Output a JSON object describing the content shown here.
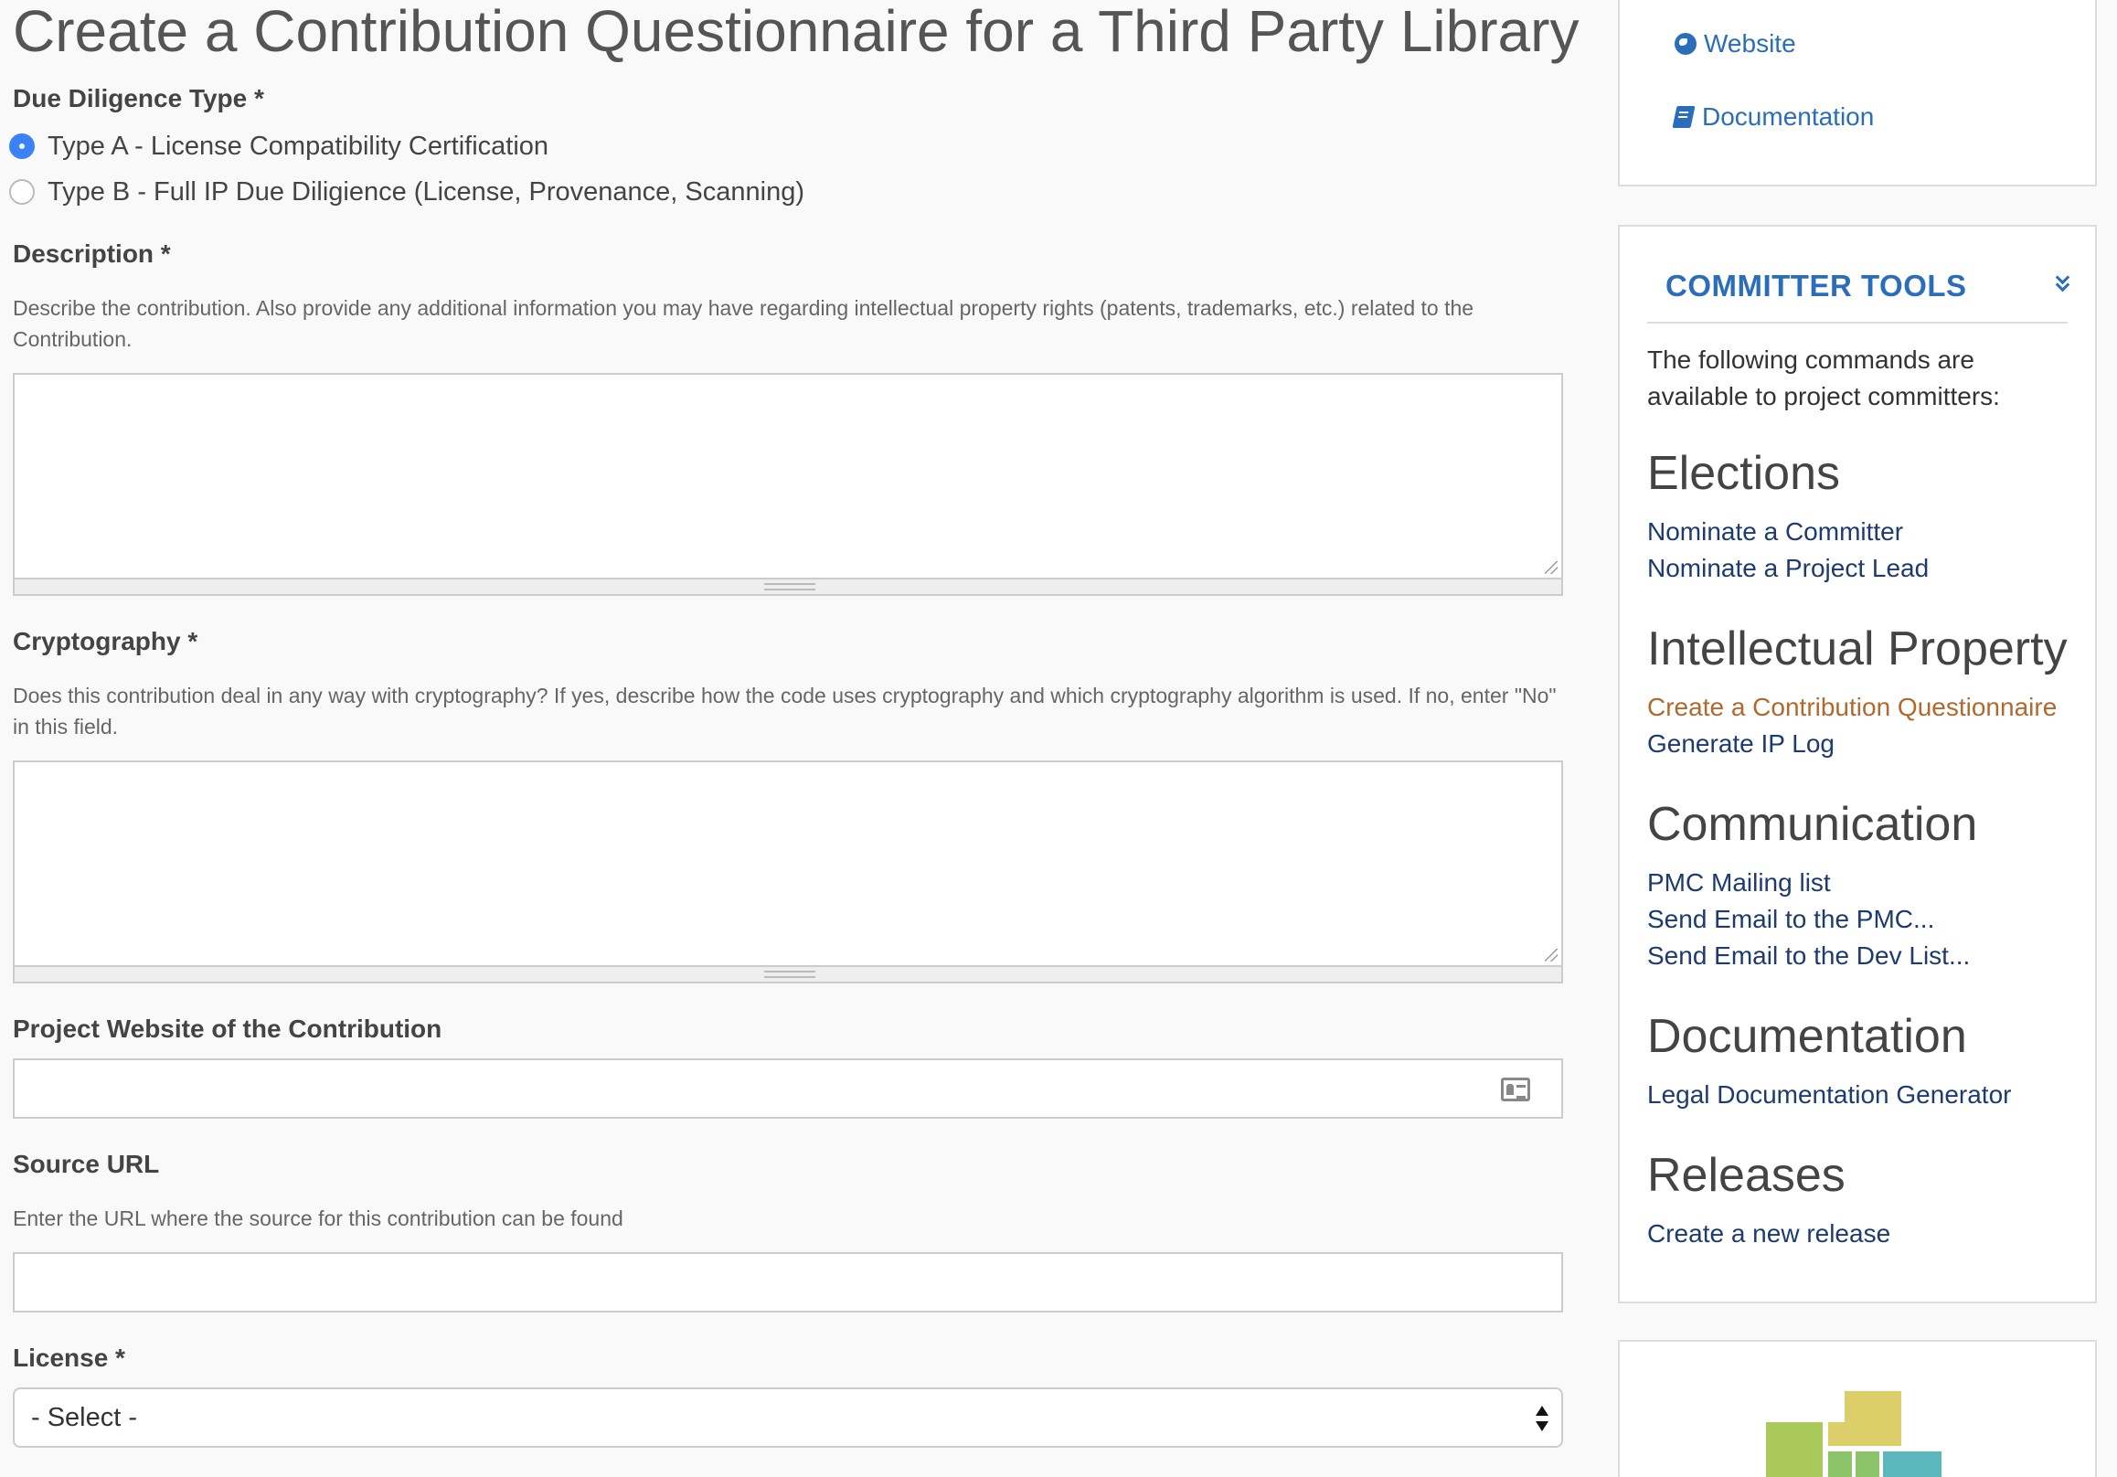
{
  "form": {
    "title": "Create a Contribution Questionnaire for a Third Party Library",
    "due_diligence": {
      "label": "Due Diligence Type *",
      "options": [
        {
          "label": "Type A - License Compatibility Certification",
          "checked": true
        },
        {
          "label": "Type B - Full IP Due Diligience (License, Provenance, Scanning)",
          "checked": false
        }
      ]
    },
    "description": {
      "label": "Description *",
      "help": "Describe the contribution. Also provide any additional information you may have regarding intellectual property rights (patents, trademarks, etc.) related to the Contribution.",
      "value": ""
    },
    "cryptography": {
      "label": "Cryptography *",
      "help": "Does this contribution deal in any way with cryptography? If yes, describe how the code uses cryptography and which cryptography algorithm is used. If no, enter \"No\" in this field.",
      "value": ""
    },
    "project_website": {
      "label": "Project Website of the Contribution",
      "value": "",
      "icon": "contact-card-icon"
    },
    "source_url": {
      "label": "Source URL",
      "help": "Enter the URL where the source for this contribution can be found",
      "value": ""
    },
    "license": {
      "label": "License *",
      "selected": "- Select -"
    }
  },
  "sidebar": {
    "links": [
      {
        "label": "Website",
        "icon": "globe-icon"
      },
      {
        "label": "Documentation",
        "icon": "book-icon"
      }
    ],
    "committer_tools": {
      "title": "COMMITTER TOOLS",
      "intro": "The following commands are available to project committers:",
      "sections": [
        {
          "heading": "Elections",
          "links": [
            "Nominate a Committer",
            "Nominate a Project Lead"
          ]
        },
        {
          "heading": "Intellectual Property",
          "links": [
            "Create a Contribution Questionnaire",
            "Generate IP Log"
          ]
        },
        {
          "heading": "Communication",
          "links": [
            "PMC Mailing list",
            "Send Email to the PMC...",
            "Send Email to the Dev List..."
          ]
        },
        {
          "heading": "Documentation",
          "links": [
            "Legal Documentation Generator"
          ]
        },
        {
          "heading": "Releases",
          "links": [
            "Create a new release"
          ]
        }
      ]
    }
  },
  "colors": {
    "link": "#2a6ebb",
    "nav_link": "#1d3b6e",
    "active_link": "#b0692e",
    "radio_checked": "#3b82f6",
    "background": "#f9f9f9"
  }
}
